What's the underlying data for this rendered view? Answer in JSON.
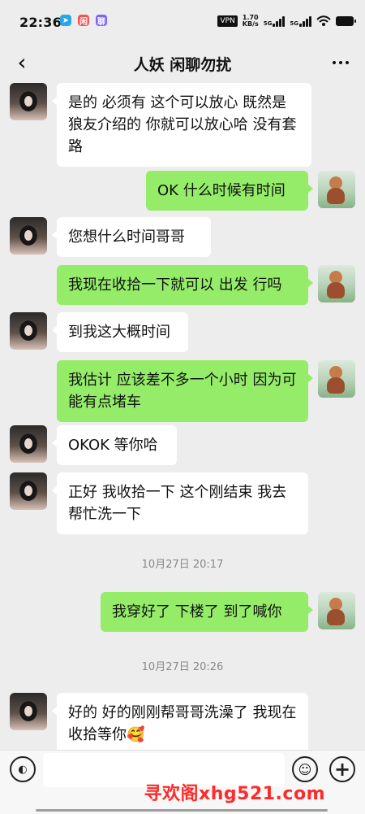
{
  "status_bar": {
    "time": "22:36",
    "vpn": "VPN",
    "speed_top": "1.70",
    "speed_bottom": "KB/s",
    "network_1": "5G",
    "network_2": "5G",
    "icons": [
      "telegram-icon",
      "app-icon-red",
      "app-icon-purple",
      "wifi-icon",
      "battery-icon"
    ]
  },
  "header": {
    "back_icon": "back-icon",
    "title": "人妖 闲聊勿扰",
    "more_icon": "more-icon"
  },
  "messages": [
    {
      "side": "left",
      "text": "是的 必须有 这个可以放心 既然是狼友介绍的 你就可以放心哈 没有套路"
    },
    {
      "side": "right",
      "text": "OK 什么时候有时间"
    },
    {
      "side": "left",
      "text": "您想什么时间哥哥"
    },
    {
      "side": "right",
      "text": "我现在收拾一下就可以 出发 行吗"
    },
    {
      "side": "left",
      "text": "到我这大概时间"
    },
    {
      "side": "right",
      "text": "我估计 应该差不多一个小时 因为可能有点堵车"
    },
    {
      "side": "left",
      "text": "OKOK 等你哈"
    },
    {
      "side": "left",
      "text": "正好 我收拾一下 这个刚结束 我去帮忙洗一下"
    },
    {
      "side": "right",
      "text": "我穿好了 下楼了 到了喊你"
    },
    {
      "side": "left",
      "text": "好的 好的刚刚帮哥哥洗澡了 我现在收拾等你🥰"
    }
  ],
  "timestamps": [
    "10月27日 20:17",
    "10月27日 20:26"
  ],
  "composer": {
    "placeholder": "",
    "voice_icon": "voice-icon",
    "emoji_icon": "emoji-icon",
    "plus_icon": "plus-icon",
    "watermark": "寻欢阁xhg521.com"
  }
}
